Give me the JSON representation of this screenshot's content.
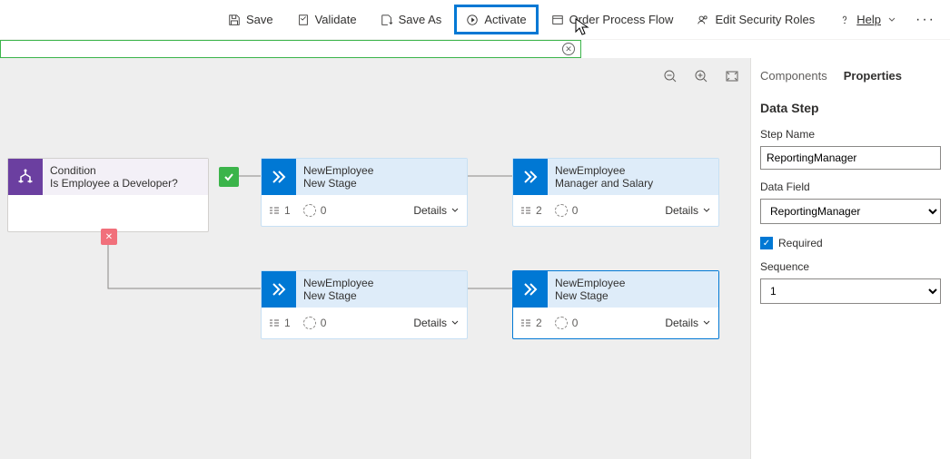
{
  "toolbar": {
    "save": "Save",
    "validate": "Validate",
    "save_as": "Save As",
    "activate": "Activate",
    "order": "Order Process Flow",
    "roles": "Edit Security Roles",
    "help": "Help"
  },
  "condition": {
    "title": "Condition",
    "subtitle": "Is Employee a Developer?"
  },
  "stages": {
    "s1": {
      "entity": "NewEmployee",
      "name": "New Stage",
      "steps": "1",
      "dur": "0",
      "details": "Details"
    },
    "s2": {
      "entity": "NewEmployee",
      "name": "Manager and Salary",
      "steps": "2",
      "dur": "0",
      "details": "Details"
    },
    "s3": {
      "entity": "NewEmployee",
      "name": "New Stage",
      "steps": "1",
      "dur": "0",
      "details": "Details"
    },
    "s4": {
      "entity": "NewEmployee",
      "name": "New Stage",
      "steps": "2",
      "dur": "0",
      "details": "Details"
    }
  },
  "panel": {
    "tab_components": "Components",
    "tab_properties": "Properties",
    "heading": "Data Step",
    "step_name_label": "Step Name",
    "step_name_value": "ReportingManager",
    "data_field_label": "Data Field",
    "data_field_value": "ReportingManager",
    "required_label": "Required",
    "sequence_label": "Sequence",
    "sequence_value": "1"
  }
}
